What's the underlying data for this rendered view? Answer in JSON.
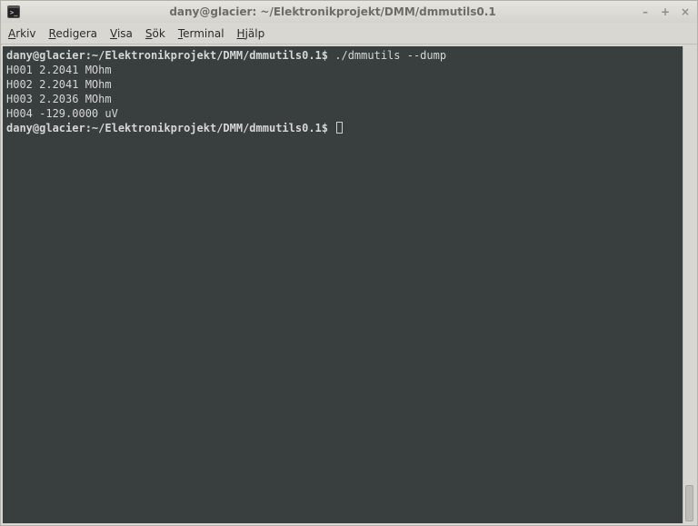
{
  "window": {
    "title": "dany@glacier: ~/Elektronikprojekt/DMM/dmmutils0.1"
  },
  "menu": {
    "arkiv": {
      "ul": "A",
      "rest": "rkiv"
    },
    "redigera": {
      "ul": "R",
      "rest": "edigera"
    },
    "visa": {
      "ul": "V",
      "rest": "isa"
    },
    "sok": {
      "ul": "S",
      "rest": "ök"
    },
    "terminal": {
      "ul": "T",
      "rest": "erminal"
    },
    "hjalp": {
      "ul": "H",
      "rest": "jälp"
    }
  },
  "terminal": {
    "prompt": "dany@glacier:~/Elektronikprojekt/DMM/dmmutils0.1$",
    "command": "./dmmutils --dump",
    "lines": {
      "l1": "H001 2.2041 MOhm",
      "l2": "H002 2.2041 MOhm",
      "l3": "H003 2.2036 MOhm",
      "l4": "H004 -129.0000 uV"
    }
  },
  "controls": {
    "minimize": "–",
    "maximize": "+",
    "close": "×"
  }
}
